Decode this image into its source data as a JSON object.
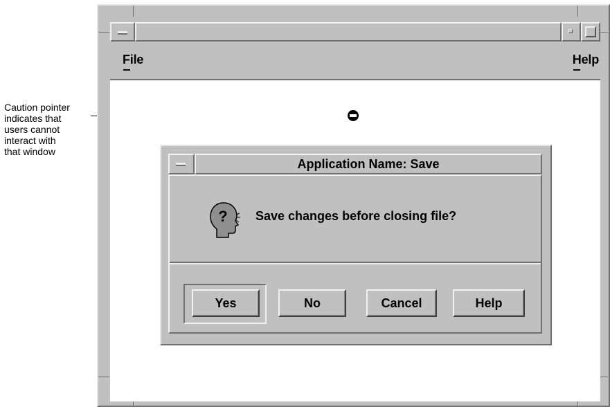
{
  "annotation": {
    "lines": [
      "Caution pointer",
      "indicates that",
      "users cannot",
      "interact with",
      "that window"
    ],
    "pointer_icon": "caution-pointer-icon"
  },
  "main_window": {
    "title": "",
    "menubar": {
      "file_label": "File",
      "help_label": "Help"
    },
    "window_controls": [
      "window-menu-icon",
      "minimize-icon",
      "maximize-icon"
    ]
  },
  "dialog": {
    "title": "Application Name: Save",
    "icon": "question-head-icon",
    "icon_glyph": "?",
    "message": "Save changes before closing file?",
    "buttons": {
      "yes": "Yes",
      "no": "No",
      "cancel": "Cancel",
      "help": "Help"
    },
    "default_button": "Yes"
  },
  "colors": {
    "panel": "#c0c0c0",
    "highlight": "#f0f0f0",
    "shadow": "#6f6f6f",
    "content": "#ffffff",
    "icon_fill": "#8f8f8f"
  }
}
